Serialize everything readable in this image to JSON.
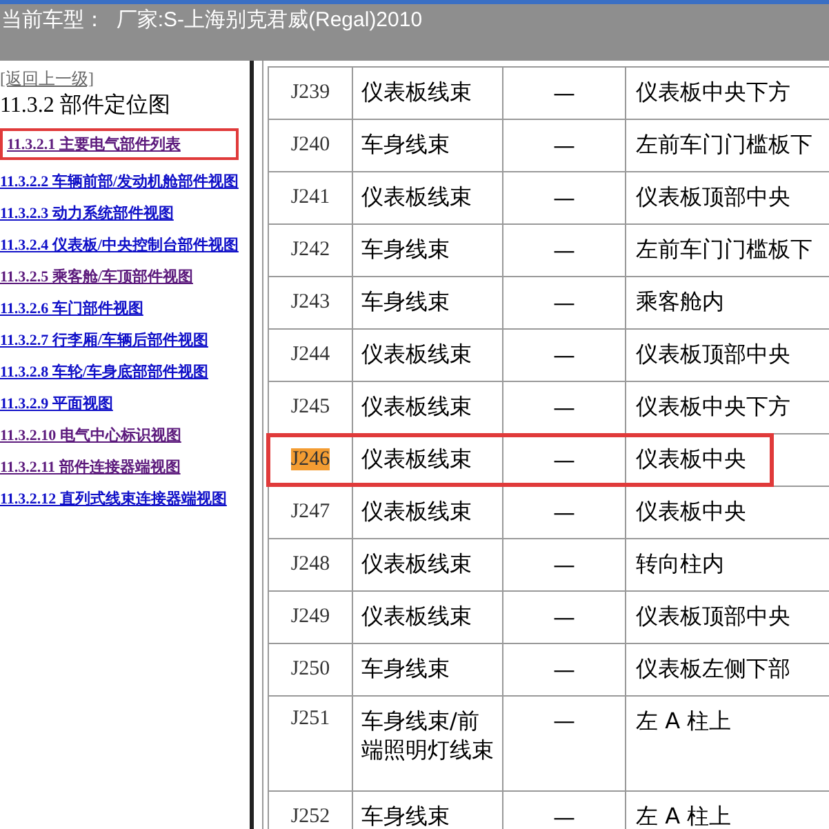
{
  "header": {
    "title": "当前车型：  厂家:S-上海别克君威(Regal)2010"
  },
  "sidebar": {
    "back_link": "[返回上一级]",
    "heading": "11.3.2 部件定位图",
    "items": [
      {
        "label": "11.3.2.1 主要电气部件列表",
        "visited": true,
        "annotated": true
      },
      {
        "label": "11.3.2.2 车辆前部/发动机舱部件视图",
        "visited": false,
        "annotated": false
      },
      {
        "label": "11.3.2.3 动力系统部件视图",
        "visited": false,
        "annotated": false
      },
      {
        "label": "11.3.2.4 仪表板/中央控制台部件视图",
        "visited": false,
        "annotated": false
      },
      {
        "label": "11.3.2.5 乘客舱/车顶部件视图",
        "visited": true,
        "annotated": false
      },
      {
        "label": "11.3.2.6 车门部件视图",
        "visited": false,
        "annotated": false
      },
      {
        "label": "11.3.2.7 行李厢/车辆后部件视图",
        "visited": false,
        "annotated": false
      },
      {
        "label": "11.3.2.8 车轮/车身底部部件视图",
        "visited": false,
        "annotated": false
      },
      {
        "label": "11.3.2.9 平面视图",
        "visited": false,
        "annotated": false
      },
      {
        "label": "11.3.2.10 电气中心标识视图",
        "visited": true,
        "annotated": false
      },
      {
        "label": "11.3.2.11 部件连接器端视图",
        "visited": true,
        "annotated": false
      },
      {
        "label": "11.3.2.12 直列式线束连接器端视图",
        "visited": false,
        "annotated": false
      }
    ]
  },
  "table": {
    "rows": [
      {
        "code": "J239",
        "harness": "仪表板线束",
        "column_3": "—",
        "location": "仪表板中央下方",
        "highlighted": false,
        "annotated": false
      },
      {
        "code": "J240",
        "harness": "车身线束",
        "column_3": "—",
        "location": "左前车门门槛板下",
        "highlighted": false,
        "annotated": false
      },
      {
        "code": "J241",
        "harness": "仪表板线束",
        "column_3": "—",
        "location": "仪表板顶部中央",
        "highlighted": false,
        "annotated": false
      },
      {
        "code": "J242",
        "harness": "车身线束",
        "column_3": "—",
        "location": "左前车门门槛板下",
        "highlighted": false,
        "annotated": false
      },
      {
        "code": "J243",
        "harness": "车身线束",
        "column_3": "—",
        "location": "乘客舱内",
        "highlighted": false,
        "annotated": false
      },
      {
        "code": "J244",
        "harness": "仪表板线束",
        "column_3": "—",
        "location": "仪表板顶部中央",
        "highlighted": false,
        "annotated": false
      },
      {
        "code": "J245",
        "harness": "仪表板线束",
        "column_3": "—",
        "location": "仪表板中央下方",
        "highlighted": false,
        "annotated": false
      },
      {
        "code": "J246",
        "harness": "仪表板线束",
        "column_3": "—",
        "location": "仪表板中央",
        "highlighted": true,
        "annotated": true
      },
      {
        "code": "J247",
        "harness": "仪表板线束",
        "column_3": "—",
        "location": "仪表板中央",
        "highlighted": false,
        "annotated": false
      },
      {
        "code": "J248",
        "harness": "仪表板线束",
        "column_3": "—",
        "location": "转向柱内",
        "highlighted": false,
        "annotated": false
      },
      {
        "code": "J249",
        "harness": "仪表板线束",
        "column_3": "—",
        "location": "仪表板顶部中央",
        "highlighted": false,
        "annotated": false
      },
      {
        "code": "J250",
        "harness": "车身线束",
        "column_3": "—",
        "location": "仪表板左侧下部",
        "highlighted": false,
        "annotated": false
      },
      {
        "code": "J251",
        "harness": "车身线束/前端照明灯线束",
        "column_3": "—",
        "location": "左 A 柱上",
        "highlighted": false,
        "annotated": false
      },
      {
        "code": "J252",
        "harness": "车身线束",
        "column_3": "—",
        "location": "左 A 柱上",
        "highlighted": false,
        "annotated": false
      }
    ]
  }
}
